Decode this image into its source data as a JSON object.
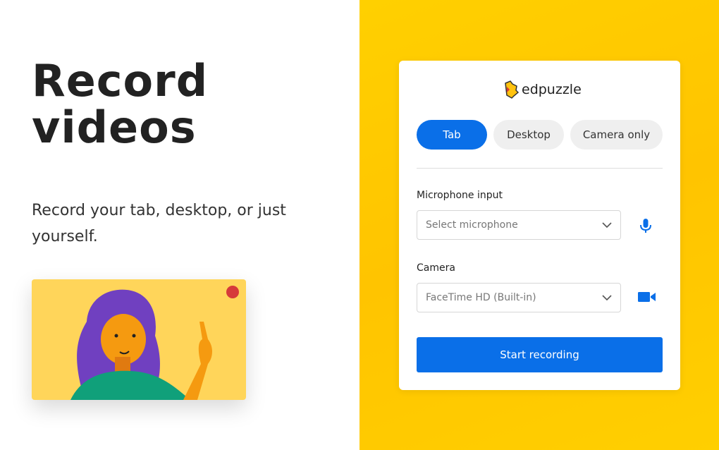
{
  "hero": {
    "title_line1": "Record",
    "title_line2": "videos",
    "subtitle": "Record your tab, desktop, or just yourself."
  },
  "card": {
    "brand": "edpuzzle",
    "tabs": [
      {
        "label": "Tab",
        "active": true
      },
      {
        "label": "Desktop",
        "active": false
      },
      {
        "label": "Camera only",
        "active": false
      }
    ],
    "microphone": {
      "label": "Microphone input",
      "placeholder": "Select microphone",
      "icon": "microphone-icon"
    },
    "camera": {
      "label": "Camera",
      "value": "FaceTime HD (Built-in)",
      "icon": "video-camera-icon"
    },
    "start_label": "Start recording"
  },
  "colors": {
    "accent": "#0a6fe8",
    "background": "#ffc800",
    "record_dot": "#d63a3a"
  }
}
